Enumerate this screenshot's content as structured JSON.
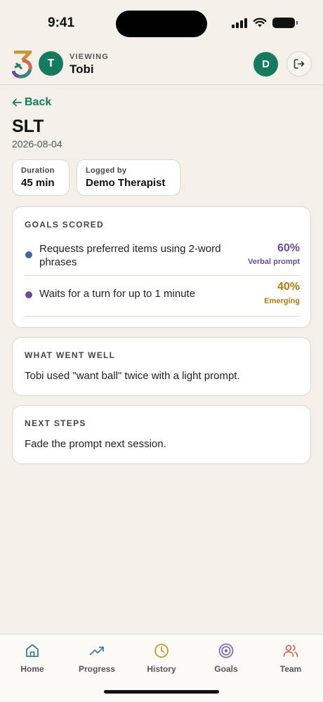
{
  "status_bar": {
    "time": "9:41"
  },
  "header": {
    "viewed_initial": "T",
    "viewing_label": "VIEWING",
    "viewing_name": "Tobi",
    "user_initial": "D"
  },
  "back": {
    "label": "Back",
    "icon": "arrow-left-icon"
  },
  "session": {
    "title": "SLT",
    "date": "2026-08-04",
    "duration_label": "Duration",
    "duration_value": "45 min",
    "logged_by_label": "Logged by",
    "logged_by_value": "Demo Therapist"
  },
  "goals_card": {
    "title": "GOALS SCORED",
    "goals": [
      {
        "description": "Requests preferred items using 2-word phrases",
        "percent": "60%",
        "level": "Verbal prompt",
        "dot_color": "#3e6a9a",
        "accent_color": "#6b4e92"
      },
      {
        "description": "Waits for a turn for up to 1 minute",
        "percent": "40%",
        "level": "Emerging",
        "dot_color": "#6b4e92",
        "accent_color": "#b07a15"
      }
    ]
  },
  "went_well": {
    "title": "WHAT WENT WELL",
    "text": "Tobi used \"want ball\" twice with a light prompt."
  },
  "next_steps": {
    "title": "NEXT STEPS",
    "text": "Fade the prompt next session."
  },
  "tabs": [
    {
      "label": "Home",
      "icon": "home-icon",
      "color": "#3f7f87"
    },
    {
      "label": "Progress",
      "icon": "trending-up-icon",
      "color": "#4a7aa8"
    },
    {
      "label": "History",
      "icon": "clock-icon",
      "color": "#c9953a"
    },
    {
      "label": "Goals",
      "icon": "target-icon",
      "color": "#7a6aa8"
    },
    {
      "label": "Team",
      "icon": "users-icon",
      "color": "#c96a55"
    }
  ]
}
